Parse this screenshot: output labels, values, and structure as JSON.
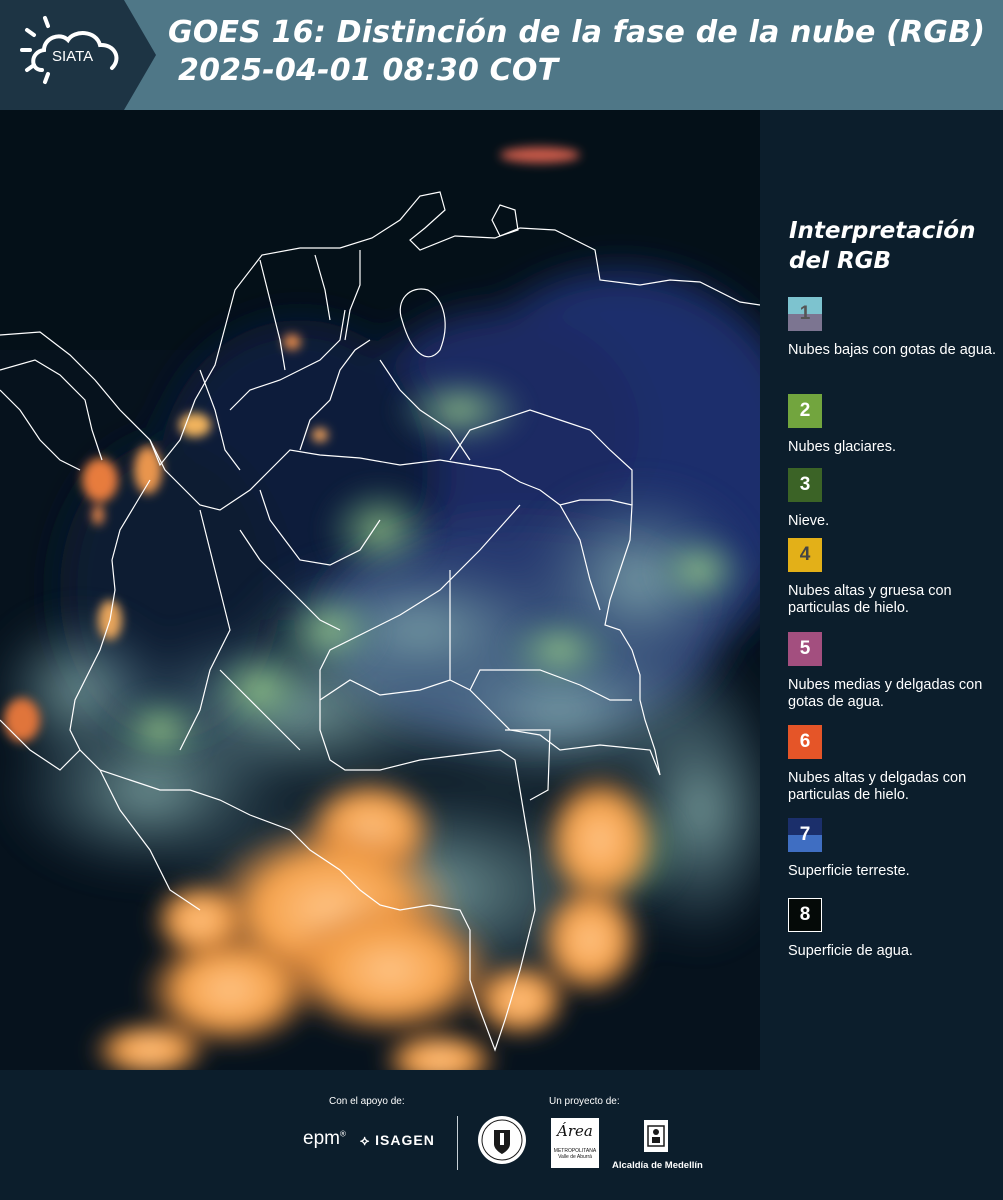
{
  "header": {
    "logo_text": "SIATA",
    "title_line1": "GOES 16: Distinción de la fase de la nube (RGB)",
    "title_line2": "2025-04-01 08:30 COT"
  },
  "legend": {
    "title": "Interpretación del RGB",
    "items": [
      {
        "number": "1",
        "label": "Nubes bajas con gotas de agua.",
        "colors": [
          "#7dc3cf",
          "#7c7591"
        ],
        "number_color": "#555555"
      },
      {
        "number": "2",
        "label": "Nubes glaciares.",
        "colors": [
          "#72a53e"
        ],
        "number_color": "#ffffff"
      },
      {
        "number": "3",
        "label": "Nieve.",
        "colors": [
          "#3b6326"
        ],
        "number_color": "#ffffff"
      },
      {
        "number": "4",
        "label": "Nubes altas y gruesa con particulas de hielo.",
        "colors": [
          "#e3b018"
        ],
        "number_color": "#444444"
      },
      {
        "number": "5",
        "label": "Nubes medias y delgadas con gotas de agua.",
        "colors": [
          "#a34f7f"
        ],
        "number_color": "#ffffff"
      },
      {
        "number": "6",
        "label": "Nubes altas y delgadas con particulas de hielo.",
        "colors": [
          "#e55528"
        ],
        "number_color": "#ffffff"
      },
      {
        "number": "7",
        "label": "Superficie terreste.",
        "colors": [
          "#1b2f6b",
          "#3f6ec2"
        ],
        "number_color": "#ffffff"
      },
      {
        "number": "8",
        "label": "Superficie de agua.",
        "colors": [
          "#050a08"
        ],
        "number_color": "#ffffff"
      }
    ]
  },
  "footer": {
    "support_caption": "Con el apoyo de:",
    "project_caption": "Un proyecto de:",
    "epm_text": "epm",
    "isagen_text": "ISAGEN",
    "area_text": "Área",
    "area_subtext": "METROPOLITANA Valle de Aburrá",
    "alcaldia_text": "Alcaldía de Medellín"
  }
}
